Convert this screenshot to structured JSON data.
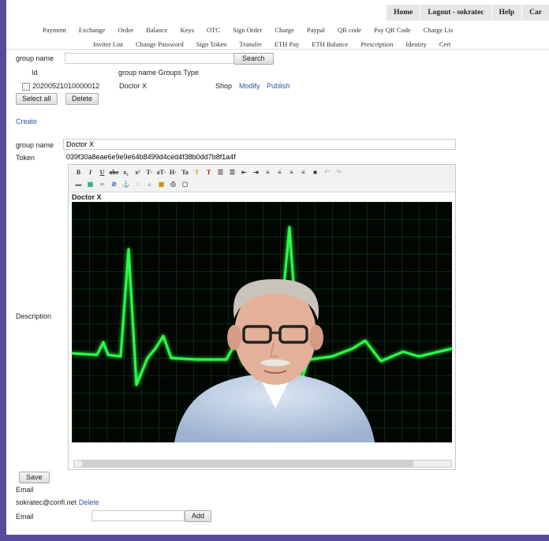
{
  "topbar": [
    "Home",
    "Logout - sokratec",
    "Help",
    "Car"
  ],
  "nav_row1": [
    "Payment",
    "Exchange",
    "Order",
    "Balance",
    "Keys",
    "OTC",
    "Sign Order",
    "Charge",
    "Paypal",
    "QR code",
    "Pay QR Code",
    "Charge Lis"
  ],
  "nav_row2": [
    "Inviter List",
    "Change Password",
    "Sign Token",
    "Transfer",
    "ETH Pay",
    "ETH Balance",
    "Prescription",
    "Identity",
    "Cert"
  ],
  "search": {
    "label": "group name",
    "value": "",
    "button": "Search"
  },
  "table": {
    "headers": [
      "Id",
      "group name Groups Type"
    ],
    "row": {
      "id": "20200521010000012",
      "name": "Doctor X",
      "type": "Shop",
      "modify": "Modify",
      "publish": "Publish"
    }
  },
  "actions": {
    "select_all": "Select all",
    "delete": "Delete"
  },
  "create_link": "Create",
  "form": {
    "group_name_label": "group name",
    "group_name_value": "Doctor X",
    "token_label": "Token",
    "token_value": "039f30a8eae6e9e9e64b8499d4ced4f38b0dd7b8f1a4f",
    "description_label": "Description",
    "editor_heading": "Doctor X",
    "save_button": "Save"
  },
  "email_section": {
    "title": "Email",
    "entry": "sokratec@confi.net",
    "delete_link": "Delete",
    "email_label": "Email",
    "email_value": "",
    "add_button": "Add"
  },
  "colors": {
    "page_border": "#5a4a9a",
    "link": "#2a55a8",
    "ecg_green": "#2bff4a",
    "grid_green": "#0a6a1a"
  }
}
